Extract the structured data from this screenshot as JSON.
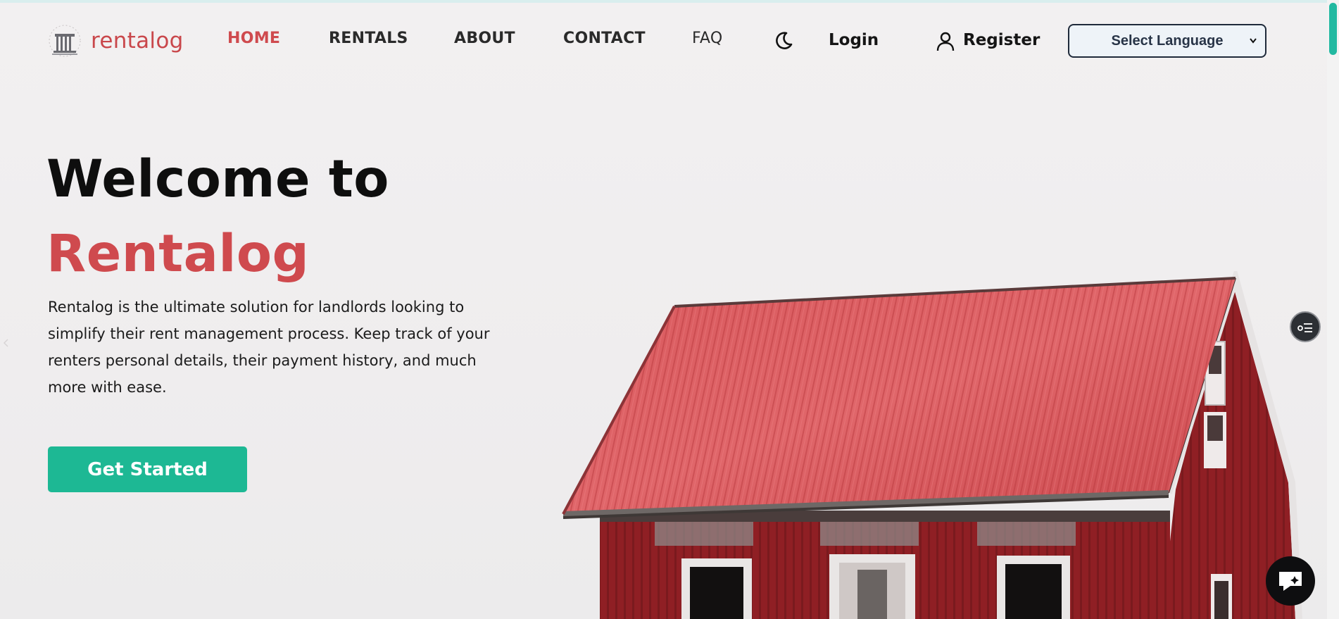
{
  "brand": {
    "name": "rentalog",
    "color": "#c9474b",
    "logo_icon": "building-icon"
  },
  "nav": {
    "links": [
      {
        "label": "HOME",
        "active": true
      },
      {
        "label": "RENTALS",
        "active": false
      },
      {
        "label": "ABOUT",
        "active": false
      },
      {
        "label": "CONTACT",
        "active": false
      },
      {
        "label": "FAQ",
        "active": false
      }
    ],
    "theme_icon": "moon-icon",
    "login_label": "Login",
    "register_label": "Register",
    "register_icon": "user-icon",
    "language_select": {
      "selected": "Select Language"
    }
  },
  "hero": {
    "heading_line1": "Welcome to",
    "heading_line2": "Rentalog",
    "description": "Rentalog is the ultimate solution for landlords looking to simplify their rent management process. Keep track of your renters personal details, their payment history, and much more with ease.",
    "cta_label": "Get Started",
    "image": "red-house-photo"
  },
  "widgets": {
    "floating_icon": "checklist-icon",
    "chat_icon": "chat-bubble-icon"
  },
  "colors": {
    "accent_red": "#cf4a4e",
    "cta_green": "#1db894",
    "text_dark": "#0e0e0e"
  }
}
